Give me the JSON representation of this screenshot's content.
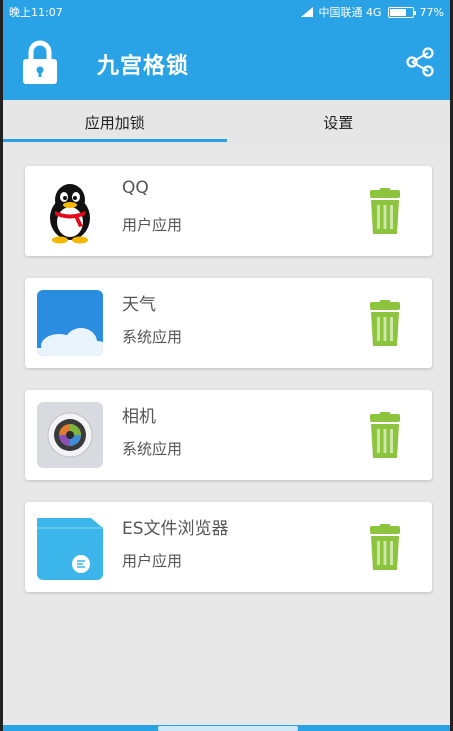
{
  "status_bar": {
    "time": "晚上11:07",
    "carrier": "中国联通 4G",
    "battery": "77%",
    "battery_level": 0.77
  },
  "app_bar": {
    "title": "九宫格锁",
    "left_icon": "lock-icon",
    "right_icon": "share-icon"
  },
  "tabs": [
    {
      "label": "应用加锁",
      "active": true
    },
    {
      "label": "设置",
      "active": false
    }
  ],
  "apps": [
    {
      "name": "QQ",
      "type": "用户应用",
      "icon": "qq-penguin-icon"
    },
    {
      "name": "天气",
      "type": "系统应用",
      "icon": "weather-cloud-icon"
    },
    {
      "name": "相机",
      "type": "系统应用",
      "icon": "camera-lens-icon"
    },
    {
      "name": "ES文件浏览器",
      "type": "用户应用",
      "icon": "es-file-explorer-icon"
    }
  ],
  "colors": {
    "primary": "#2aa3e6",
    "trash": "#8cc43f",
    "background": "#e8e8e8"
  }
}
